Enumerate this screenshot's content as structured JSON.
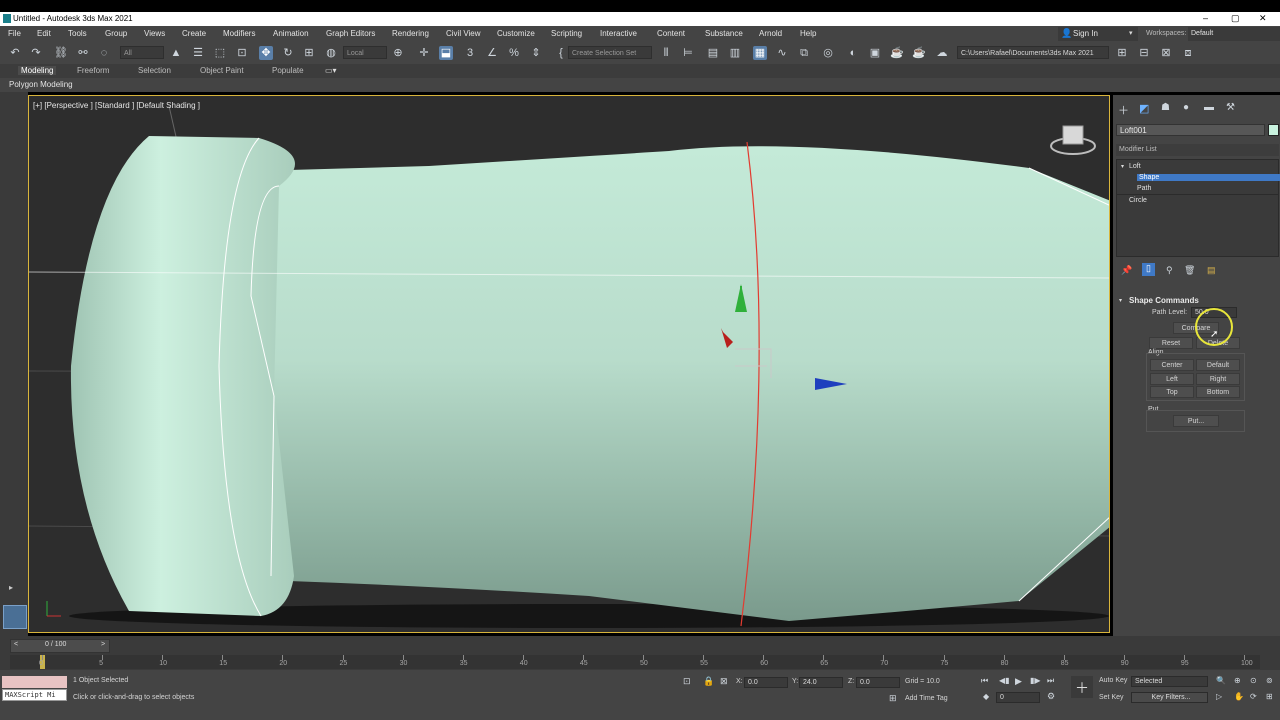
{
  "title_bar": {
    "title": "Untitled - Autodesk 3ds Max 2021",
    "minimize": "–",
    "maximize": "▢",
    "close": "✕"
  },
  "menu": [
    "File",
    "Edit",
    "Tools",
    "Group",
    "Views",
    "Create",
    "Modifiers",
    "Animation",
    "Graph Editors",
    "Rendering",
    "Civil View",
    "Customize",
    "Scripting",
    "Interactive",
    "Content",
    "Substance",
    "Arnold",
    "Help"
  ],
  "account": {
    "sign_in": "Sign In",
    "workspaces_label": "Workspaces:",
    "workspace_value": "Default"
  },
  "toolbar": {
    "filter_value": "All",
    "coord_value": "Local",
    "selection_set_placeholder": "Create Selection Set",
    "project_path": "C:\\Users\\Rafael\\Documents\\3ds Max 2021"
  },
  "ribbon": {
    "tabs": [
      "Modeling",
      "Freeform",
      "Selection",
      "Object Paint",
      "Populate"
    ],
    "active_tab": "Modeling",
    "sub_label": "Polygon Modeling"
  },
  "viewport": {
    "label": "[+] [Perspective ] [Standard ] [Default Shading ]"
  },
  "command_panel": {
    "object_name": "Loft001",
    "modifier_list": "Modifier List",
    "stack": [
      "Loft",
      "Shape",
      "Path",
      "Circle"
    ],
    "stack_selected": "Shape",
    "rollout_title": "Shape Commands",
    "path_level_label": "Path Level:",
    "path_level_value": "50.0",
    "compare_button": "Compare",
    "reset_button": "Reset",
    "delete_button": "Delete",
    "align_label": "Align",
    "align_buttons": [
      "Center",
      "Default",
      "Left",
      "Right",
      "Top",
      "Bottom"
    ],
    "put_label": "Put",
    "put_button": "Put..."
  },
  "timeline": {
    "frame_counter": "0 / 100",
    "ticks": [
      "0",
      "5",
      "10",
      "15",
      "20",
      "25",
      "30",
      "35",
      "40",
      "45",
      "50",
      "55",
      "60",
      "65",
      "70",
      "75",
      "80",
      "85",
      "90",
      "95",
      "100"
    ]
  },
  "status": {
    "maxscript": "MAXScript Mi",
    "selection_status": "1 Object Selected",
    "prompt": "Click or click-and-drag to select objects",
    "x_label": "X:",
    "x_value": "0.0",
    "y_label": "Y:",
    "y_value": "24.0",
    "z_label": "Z:",
    "z_value": "0.0",
    "grid": "Grid = 10.0",
    "add_time_tag": "Add Time Tag",
    "auto_key": "Auto Key",
    "set_key": "Set Key",
    "key_mode_value": "Selected",
    "key_filters": "Key Filters...",
    "frame_value": "0"
  },
  "colors": {
    "object_fill": "#c8eedc",
    "viewport_border": "#d9b53b",
    "selection_blue": "#3f79c6"
  }
}
